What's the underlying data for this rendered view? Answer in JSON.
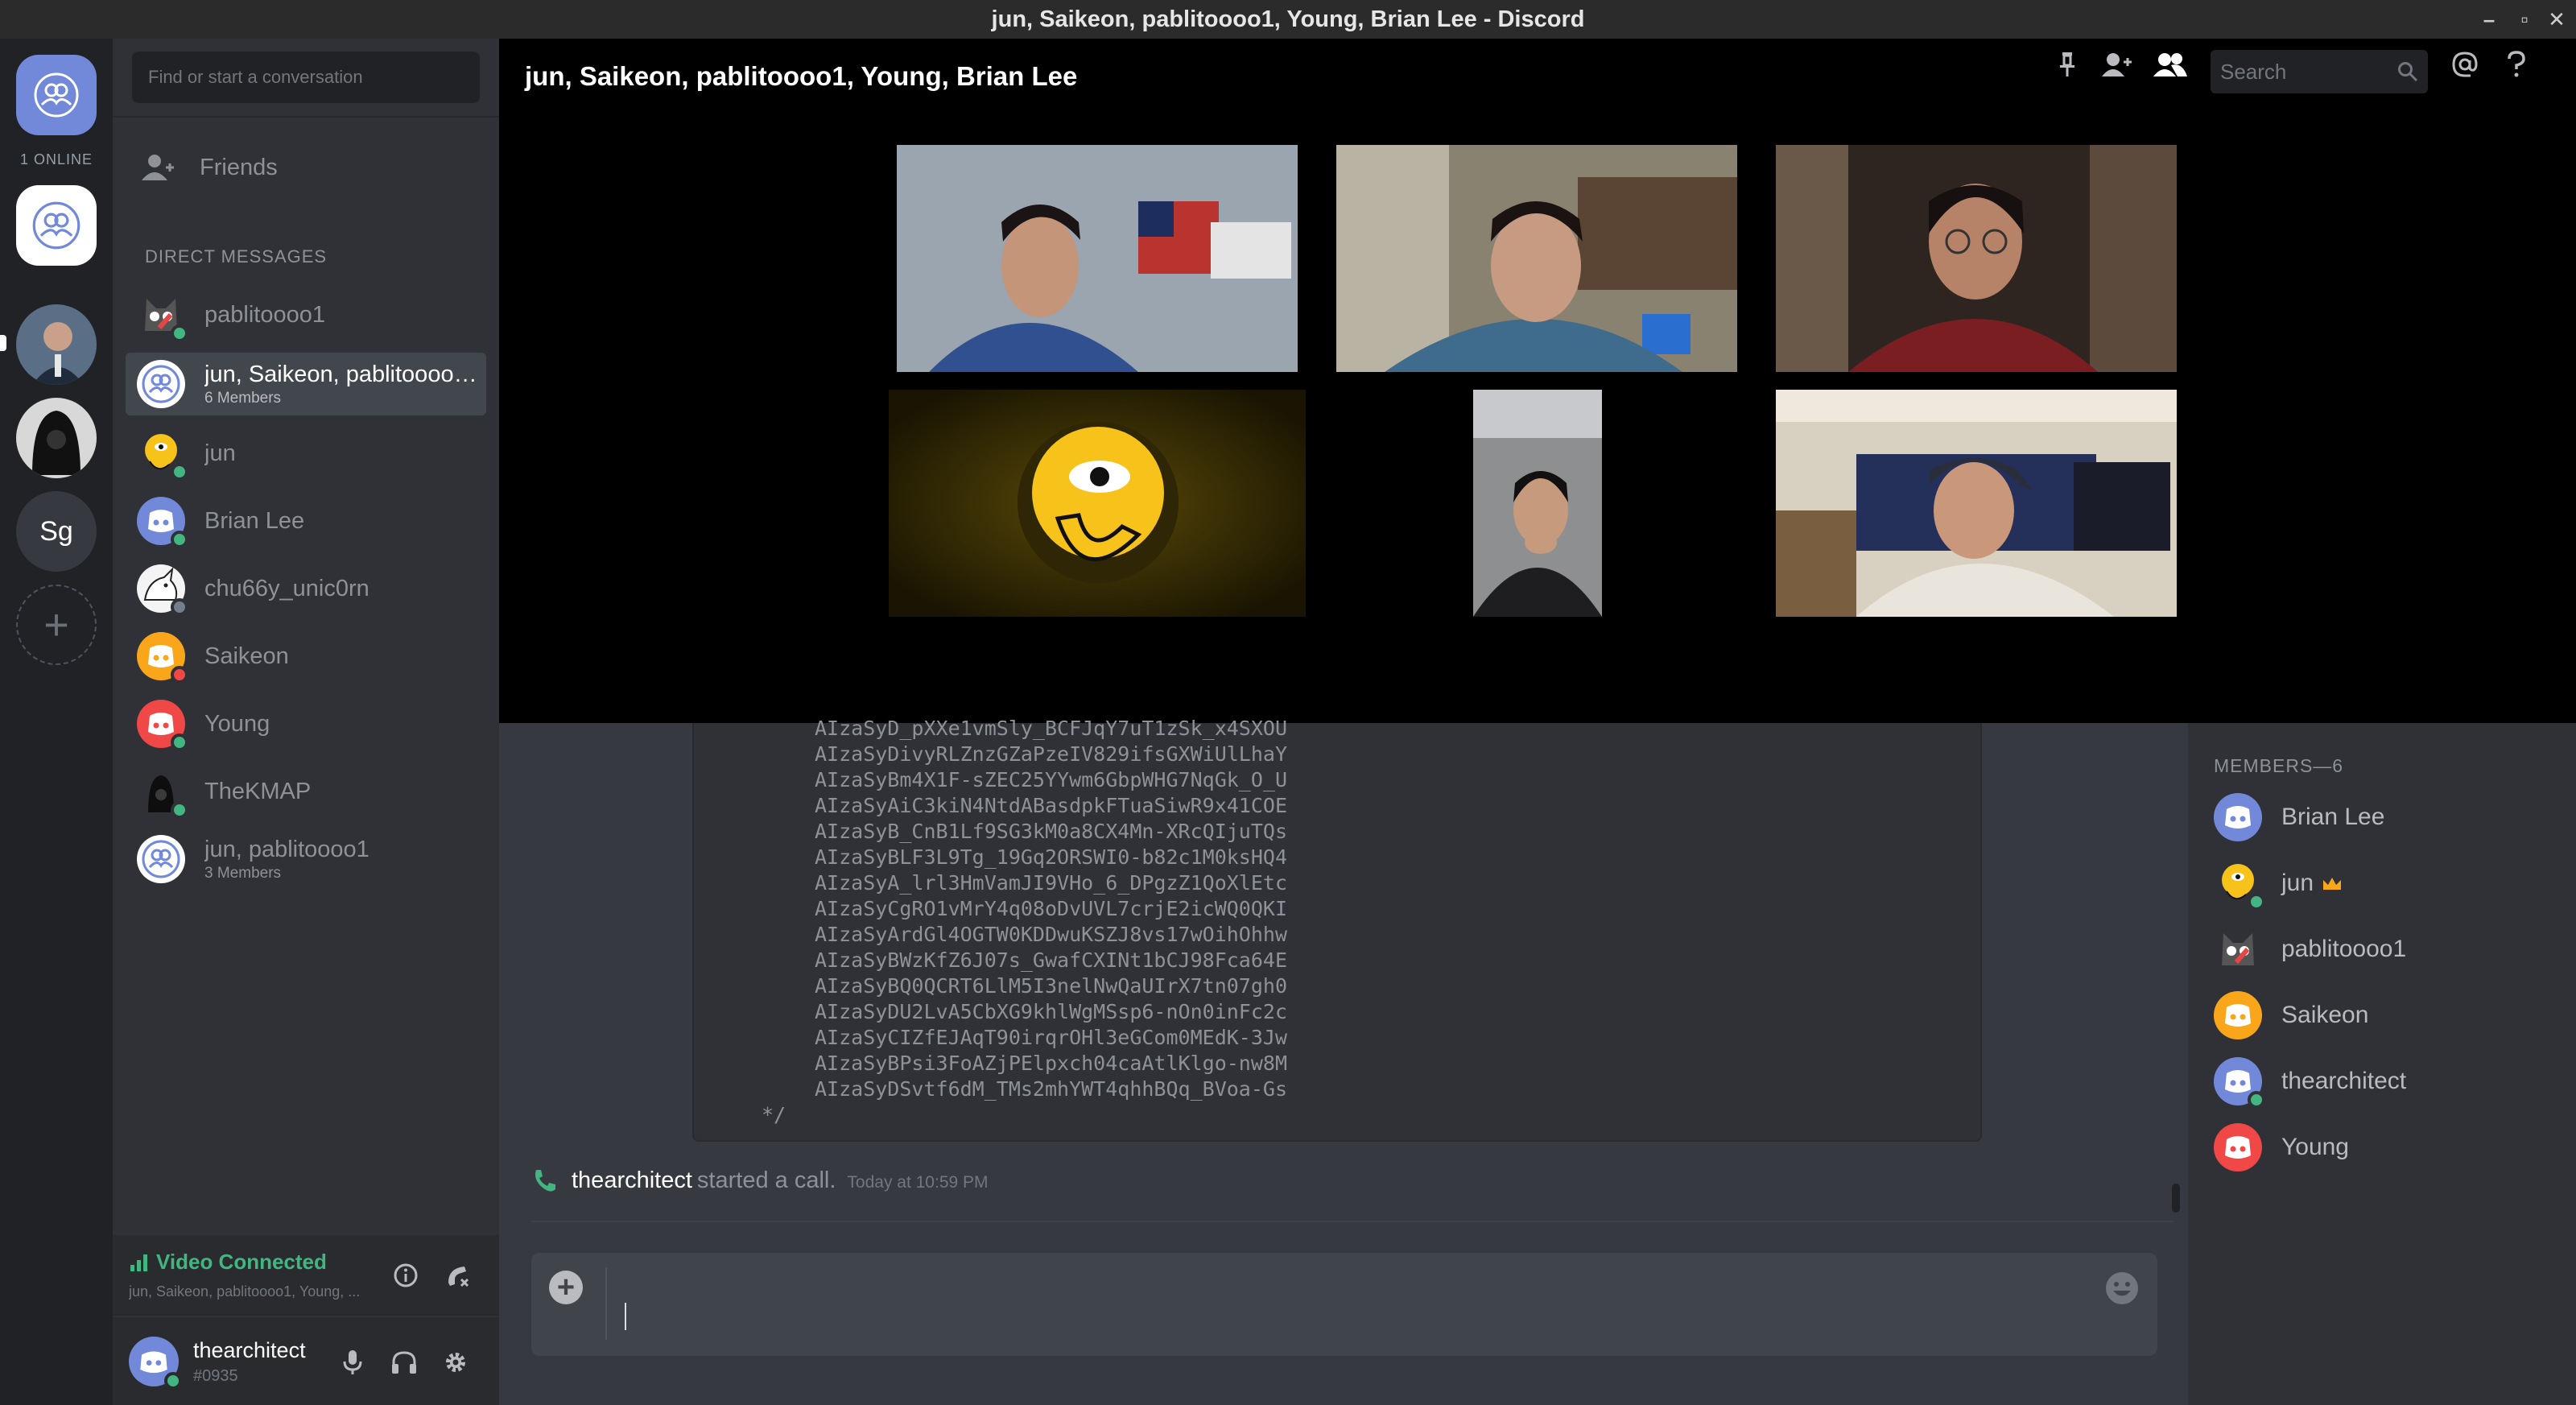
{
  "window": {
    "title": "jun, Saikeon, pablitoooo1, Young, Brian Lee - Discord"
  },
  "servers": {
    "online_label": "1 ONLINE",
    "sg_label": "Sg"
  },
  "dms": {
    "search_placeholder": "Find or start a conversation",
    "friends_label": "Friends",
    "header": "DIRECT MESSAGES",
    "items": [
      {
        "name": "pablitoooo1",
        "sub": "",
        "status": "online"
      },
      {
        "name": "jun, Saikeon, pablitoooo1, Young, Brian Lee",
        "sub": "6 Members",
        "status": ""
      },
      {
        "name": "jun",
        "sub": "",
        "status": "online"
      },
      {
        "name": "Brian Lee",
        "sub": "",
        "status": "online"
      },
      {
        "name": "chu66y_unic0rn",
        "sub": "",
        "status": "offline"
      },
      {
        "name": "Saikeon",
        "sub": "",
        "status": "dnd"
      },
      {
        "name": "Young",
        "sub": "",
        "status": "online"
      },
      {
        "name": "TheKMAP",
        "sub": "",
        "status": "online"
      },
      {
        "name": "jun, pablitoooo1",
        "sub": "3 Members",
        "status": ""
      }
    ]
  },
  "voice": {
    "title": "Video Connected",
    "sub": "jun, Saikeon, pablitoooo1, Young, ..."
  },
  "user": {
    "name": "thearchitect",
    "discriminator": "#0935"
  },
  "call": {
    "title": "jun, Saikeon, pablitoooo1, Young, Brian Lee",
    "search_placeholder": "Search"
  },
  "code": {
    "lines": [
      "AIzaSyD_pXXe1vmSly_BCFJqY7uT1zSk_x4SXOU",
      "AIzaSyDivyRLZnzGZaPzeIV829ifsGXWiUlLhaY",
      "AIzaSyBm4X1F-sZEC25YYwm6GbpWHG7NqGk_O_U",
      "AIzaSyAiC3kiN4NtdABasdpkFTuaSiwR9x41COE",
      "AIzaSyB_CnB1Lf9SG3kM0a8CX4Mn-XRcQIjuTQs",
      "AIzaSyBLF3L9Tg_19Gq2ORSWI0-b82c1M0ksHQ4",
      "AIzaSyA_lrl3HmVamJI9VHo_6_DPgzZ1QoXlEtc",
      "AIzaSyCgRO1vMrY4q08oDvUVL7crjE2icWQ0QKI",
      "AIzaSyArdGl4OGTW0KDDwuKSZJ8vs17wOihOhhw",
      "AIzaSyBWzKfZ6J07s_GwafCXINt1bCJ98Fca64E",
      "AIzaSyBQ0QCRT6LlM5I3nelNwQaUIrX7tn07gh0",
      "AIzaSyDU2LvA5CbXG9khlWgMSsp6-nOn0inFc2c",
      "AIzaSyCIZfEJAqT90irqrOHl3eGCom0MEdK-3Jw",
      "AIzaSyBPsi3FoAZjPElpxch04caAtlKlgo-nw8M",
      "AIzaSyDSvtf6dM_TMs2mhYWT4qhhBQq_BVoa-Gs"
    ],
    "end": "*/"
  },
  "system_message": {
    "user": "thearchitect",
    "action": "started a call.",
    "time": "Today at 10:59 PM"
  },
  "members": {
    "header": "MEMBERS—6",
    "list": [
      {
        "name": "Brian Lee",
        "status": ""
      },
      {
        "name": "jun",
        "status": "online",
        "owner": true
      },
      {
        "name": "pablitoooo1",
        "status": ""
      },
      {
        "name": "Saikeon",
        "status": ""
      },
      {
        "name": "thearchitect",
        "status": "online"
      },
      {
        "name": "Young",
        "status": ""
      }
    ]
  },
  "colors": {
    "blurple": "#7289da",
    "online": "#43b581",
    "dnd": "#f04747",
    "offline": "#747f8d",
    "saikeon_orange": "#faa61a",
    "young_red": "#f04747"
  }
}
